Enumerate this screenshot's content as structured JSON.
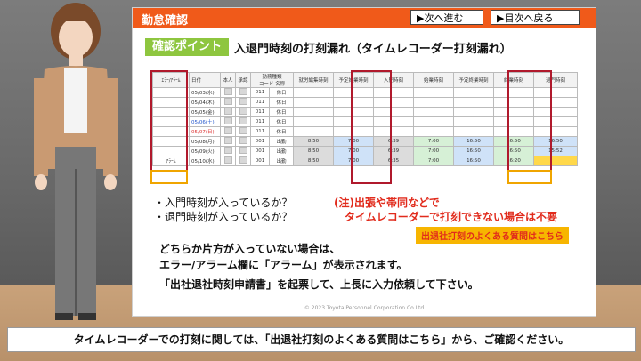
{
  "slide": {
    "title": "勤怠確認",
    "nav": {
      "next": "▶次へ進む",
      "toc": "▶目次へ戻る"
    },
    "badge": "確認ポイント",
    "heading": "入退門時刻の打刻漏れ（タイムレコーダー打刻漏れ）"
  },
  "table": {
    "headers": [
      "ｴﾗｰ/ｱﾗｰﾑ",
      "日付",
      "本人",
      "承認",
      "勤務種類",
      "",
      "就労編集時刻",
      "予定始業時刻",
      "入門時刻",
      "始業時刻",
      "予定終業時刻",
      "終業時刻",
      "退門時刻"
    ],
    "subheaders": [
      "コード",
      "名称"
    ],
    "rows": [
      {
        "err": "",
        "date": "05/03(水)",
        "code": "011",
        "name": "休日",
        "v1": "",
        "v2": "",
        "in": "",
        "s1": "",
        "s2": "",
        "e1": "",
        "out": ""
      },
      {
        "err": "",
        "date": "05/04(木)",
        "code": "011",
        "name": "休日",
        "v1": "",
        "v2": "",
        "in": "",
        "s1": "",
        "s2": "",
        "e1": "",
        "out": ""
      },
      {
        "err": "",
        "date": "05/05(金)",
        "code": "011",
        "name": "休日",
        "v1": "",
        "v2": "",
        "in": "",
        "s1": "",
        "s2": "",
        "e1": "",
        "out": ""
      },
      {
        "err": "",
        "date": "05/06(土)",
        "code": "011",
        "name": "休日",
        "v1": "",
        "v2": "",
        "in": "",
        "s1": "",
        "s2": "",
        "e1": "",
        "out": ""
      },
      {
        "err": "",
        "date": "05/07(日)",
        "code": "011",
        "name": "休日",
        "v1": "",
        "v2": "",
        "in": "",
        "s1": "",
        "s2": "",
        "e1": "",
        "out": ""
      },
      {
        "err": "",
        "date": "05/08(月)",
        "code": "001",
        "name": "出勤",
        "v1": "8:50",
        "v2": "7:00",
        "in": "6:39",
        "s1": "7:00",
        "s2": "16:50",
        "e1": "16:50",
        "out": "16:50"
      },
      {
        "err": "",
        "date": "05/09(火)",
        "code": "001",
        "name": "出勤",
        "v1": "8:50",
        "v2": "7:00",
        "in": "6:39",
        "s1": "7:00",
        "s2": "16:50",
        "e1": "16:50",
        "out": "15:52"
      },
      {
        "err": "ｱﾗｰﾑ",
        "date": "05/10(水)",
        "code": "001",
        "name": "出勤",
        "v1": "8:50",
        "v2": "7:00",
        "in": "6:35",
        "s1": "7:00",
        "s2": "16:50",
        "e1": "16:20",
        "out": ""
      }
    ]
  },
  "bullets": [
    "・入門時刻が入っているか？",
    "・退門時刻が入っているか？"
  ],
  "note1": "(注)出張や帯同などで",
  "note2": "タイムレコーダーで打刻できない場合は不要",
  "faq_button": "出退社打刻のよくある質問はこちら",
  "body": [
    "どちらか片方が入っていない場合は、",
    "エラー/アラーム欄に「アラーム」が表示されます。",
    "「出社退社時刻申請書」を起票して、上長に入力依頼して下さい。"
  ],
  "copyright": "© 2023 Toyota Personnel Corporation Co.Ltd",
  "subtitle": "タイムレコーダーでの打刻に関しては、「出退社打刻のよくある質問はこちら」から、ご確認ください。",
  "colors": {
    "header": "#f05a1a",
    "badge": "#8ec63f",
    "alert_box": "#b0192c",
    "faq_bg": "#f7b500",
    "note": "#e12b1c"
  }
}
